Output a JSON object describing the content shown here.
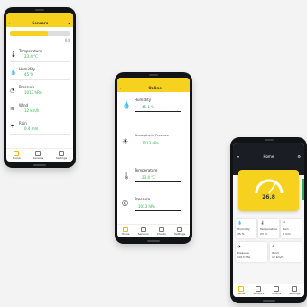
{
  "phone1": {
    "title": "Sensors",
    "brightness_value": "64",
    "sensors": [
      {
        "icon": "thermometer-icon",
        "label": "Temperature",
        "value": "23.4 °C"
      },
      {
        "icon": "humidity-icon",
        "label": "Humidity",
        "value": "45 %"
      },
      {
        "icon": "pressure-icon",
        "label": "Pressure",
        "value": "1013 hPa"
      },
      {
        "icon": "wind-icon",
        "label": "Wind",
        "value": "12 km/h"
      },
      {
        "icon": "rain-icon",
        "label": "Rain",
        "value": "0.4 mm"
      }
    ],
    "nav": [
      "Home",
      "Sensors",
      "Settings"
    ]
  },
  "phone2": {
    "title": "Online",
    "sensors": [
      {
        "icon": "drop-icon",
        "label": "Humidity",
        "value": "45.1 %"
      },
      {
        "icon": "sun-icon",
        "label": "Atmospheric Pressure",
        "value": "1013 hPa"
      },
      {
        "icon": "thermometer-icon",
        "label": "Temperature",
        "value": "23.4 °C"
      },
      {
        "icon": "gauge-icon",
        "label": "Pressure",
        "value": "1013 hPa"
      }
    ],
    "nav": [
      "Home",
      "Sensors",
      "Charts",
      "Settings"
    ]
  },
  "phone3": {
    "title": "Home",
    "gauge_value": "26.8",
    "tiles": [
      {
        "label": "Humidity",
        "value": "45 %"
      },
      {
        "label": "Temperature",
        "value": "23 °C"
      },
      {
        "label": "Rain",
        "value": "0 mm"
      },
      {
        "label": "Pressure",
        "value": "1013 hPa"
      },
      {
        "label": "Wind",
        "value": "12 km/h"
      }
    ],
    "nav": [
      "Home",
      "Sensors",
      "Charts",
      "Settings"
    ]
  },
  "colors": {
    "accent": "#f6d21f",
    "good": "#2fae4f",
    "dark": "#121316"
  }
}
